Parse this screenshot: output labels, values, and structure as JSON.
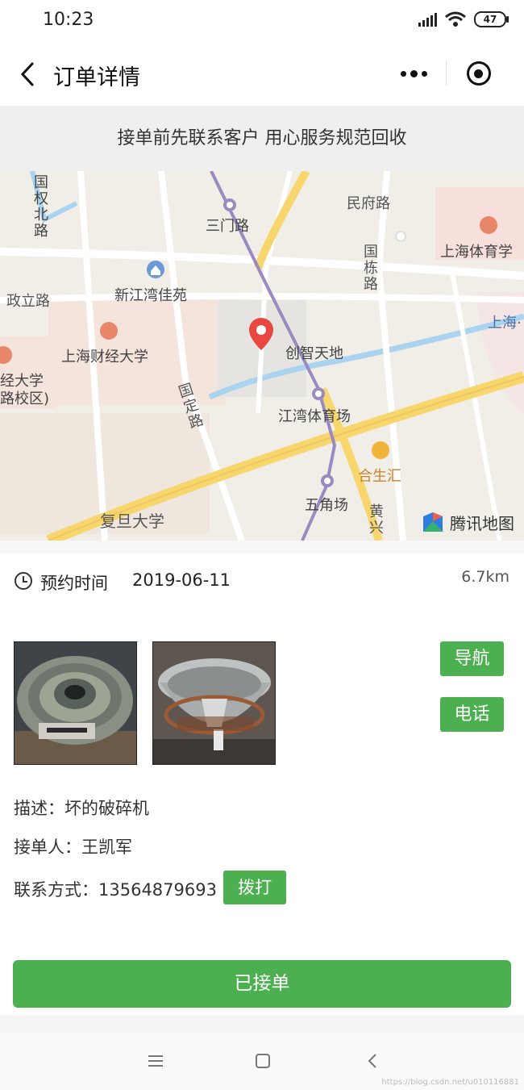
{
  "status_bar": {
    "time": "10:23",
    "battery": "47"
  },
  "nav": {
    "title": "订单详情"
  },
  "notice": "接单前先联系客户 用心服务规范回收",
  "map": {
    "labels": {
      "guoquan_bei_lu": "国权北路",
      "sanmen_lu": "三门路",
      "minfu_lu": "民府路",
      "shanghai_tiyu": "上海体育学",
      "guodong_lu": "国栋路",
      "xinjiangwan": "新江湾佳苑",
      "zhengli_lu": "政立路",
      "shanghai_right": "上海·",
      "chuangzhi": "创智天地",
      "caijing": "上海财经大学",
      "jingda": "经大学",
      "luxiao": "路校区)",
      "guoding_lu": "国定路",
      "jiangwan_tiyuchang": "江湾体育场",
      "heshenghui": "合生汇",
      "wujiaochang": "五角场",
      "fudan": "复旦大学",
      "huangxing": "黄兴"
    },
    "logo": "腾讯地图"
  },
  "info": {
    "appointment_label": "预约时间",
    "appointment_date": "2019-06-11",
    "distance": "6.7km",
    "navigate_label": "导航",
    "phone_label": "电话",
    "description": "描述：坏的破碎机",
    "receiver": "接单人：王凯军",
    "contact": "联系方式：13564879693",
    "dial_label": "拨打",
    "accepted_label": "已接单"
  },
  "watermark": "https://blog.csdn.net/u010116881",
  "colors": {
    "accent": "#4caf50",
    "pin": "#e8483f"
  }
}
